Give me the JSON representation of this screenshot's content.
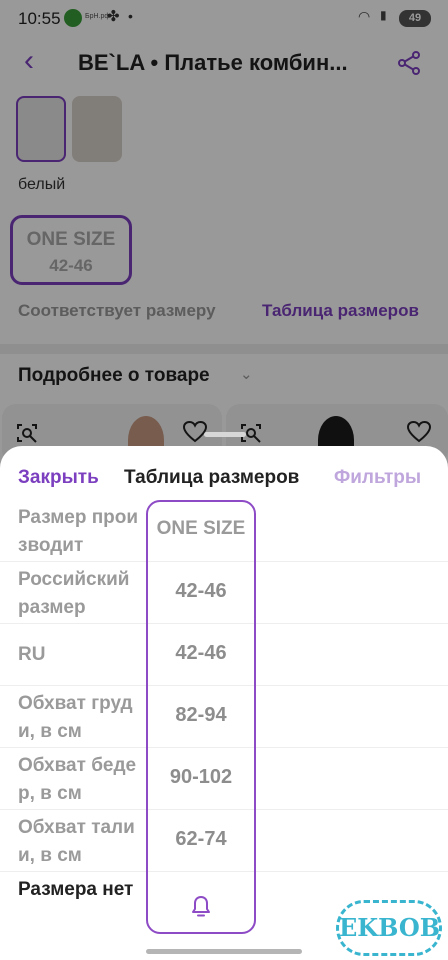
{
  "status_bar": {
    "time": "10:55",
    "app_tiny": "БрН.рф",
    "battery": "49"
  },
  "header": {
    "title": "BE`LA • Платье комбин..."
  },
  "product": {
    "color_label": "белый",
    "size_chip": {
      "top": "ONE SIZE",
      "bottom": "42-46"
    },
    "fit_text": "Соответствует размеру",
    "size_table_link": "Таблица размеров",
    "more_details": "Подробнее о товаре"
  },
  "sheet": {
    "close_label": "Закрыть",
    "title": "Таблица размеров",
    "filters_label": "Фильтры",
    "rows": [
      {
        "label": "Размер производит",
        "value": "ONE SIZE"
      },
      {
        "label": "Российский размер",
        "value": "42-46"
      },
      {
        "label": "RU",
        "value": "42-46"
      },
      {
        "label": "Обхват груди, в см",
        "value": "82-94"
      },
      {
        "label": "Обхват бедер, в см",
        "value": "90-102"
      },
      {
        "label": "Обхват талии, в см",
        "value": "62-74"
      },
      {
        "label": "Размера нет",
        "value": ""
      }
    ]
  },
  "watermark": "EKBOB",
  "colors": {
    "accent": "#7b3fbf",
    "muted_accent": "#bfa6dc",
    "text": "#222222",
    "muted_text": "#9a9a9a"
  }
}
